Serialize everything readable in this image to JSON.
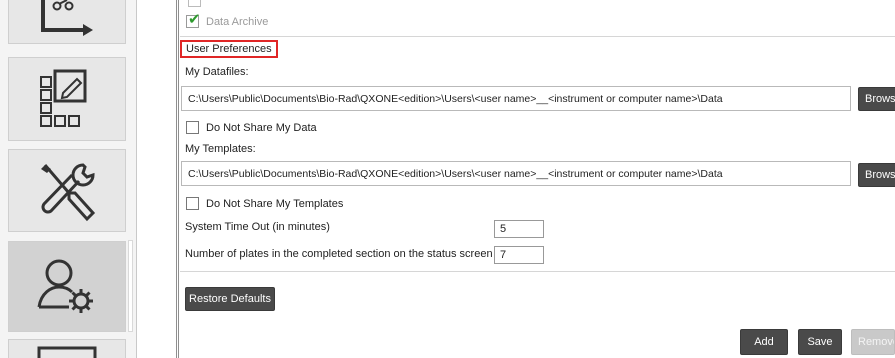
{
  "nav": {
    "items": [
      {
        "icon": "plate-export-icon"
      },
      {
        "icon": "plate-editor-icon"
      },
      {
        "icon": "tools-icon"
      },
      {
        "icon": "user-settings-icon",
        "active": true
      },
      {
        "icon": "monitor-icon"
      }
    ]
  },
  "data_archive": {
    "label": "Data Archive",
    "checked": true
  },
  "user_preferences": {
    "title": "User Preferences",
    "my_datafiles": {
      "label": "My Datafiles:",
      "path": "C:\\Users\\Public\\Documents\\Bio-Rad\\QXONE<edition>\\Users\\<user name>__<instrument or computer name>\\Data",
      "browse_label": "Browse"
    },
    "do_not_share_data": {
      "label": "Do Not Share My Data",
      "checked": false
    },
    "my_templates": {
      "label": "My Templates:",
      "path": "C:\\Users\\Public\\Documents\\Bio-Rad\\QXONE<edition>\\Users\\<user name>__<instrument or computer name>\\Data",
      "browse_label": "Browse"
    },
    "do_not_share_templates": {
      "label": "Do Not Share My Templates",
      "checked": false
    },
    "timeout": {
      "label": "System Time Out (in minutes)",
      "value": "5"
    },
    "plates_count": {
      "label": "Number of plates in the completed section on the status screen",
      "value": "7"
    },
    "restore_defaults_label": "Restore Defaults"
  },
  "footer": {
    "add_label": "Add",
    "save_label": "Save",
    "remove_label": "Remove"
  },
  "colors": {
    "highlight_border": "#e02626",
    "button_dark": "#4a4a4a",
    "check_green": "#2e9a2e"
  }
}
